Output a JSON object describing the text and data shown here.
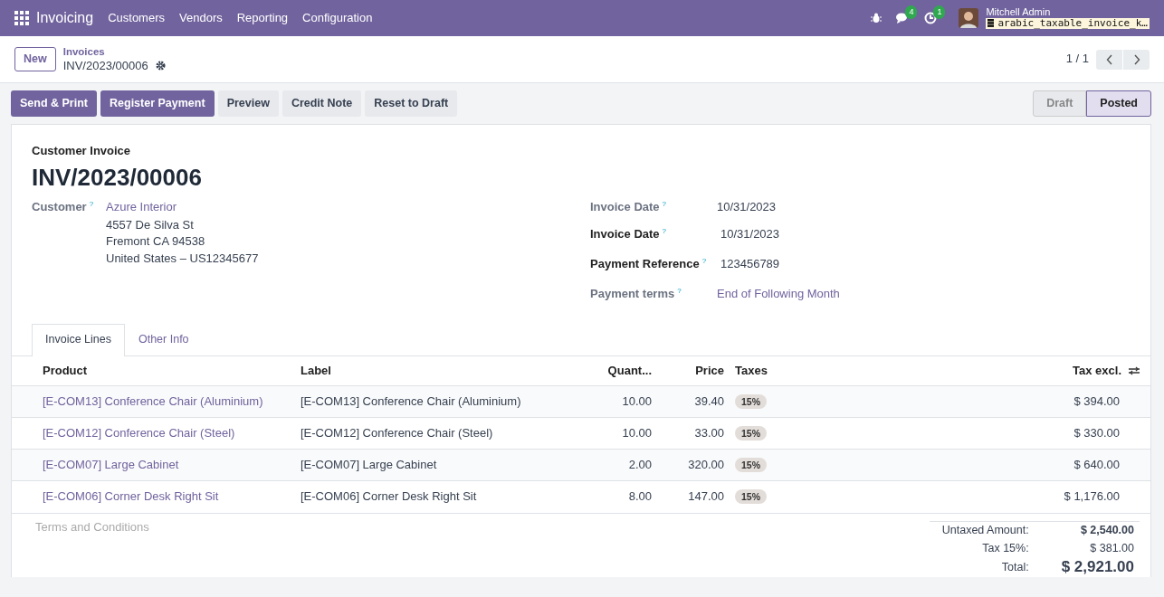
{
  "navbar": {
    "app": "Invoicing",
    "menus": [
      "Customers",
      "Vendors",
      "Reporting",
      "Configuration"
    ],
    "messages_count": "4",
    "activities_count": "1",
    "user": "Mitchell Admin",
    "database": "arabic_taxable_invoice_k…"
  },
  "control_panel": {
    "new_button": "New",
    "breadcrumb": "Invoices",
    "record": "INV/2023/00006",
    "pager": "1 / 1"
  },
  "actions": [
    {
      "label": "Send & Print",
      "primary": true
    },
    {
      "label": "Register Payment",
      "primary": true
    },
    {
      "label": "Preview",
      "primary": false
    },
    {
      "label": "Credit Note",
      "primary": false
    },
    {
      "label": "Reset to Draft",
      "primary": false
    }
  ],
  "status": [
    {
      "label": "Draft",
      "selected": false
    },
    {
      "label": "Posted",
      "selected": true
    }
  ],
  "form": {
    "type_label": "Customer Invoice",
    "name": "INV/2023/00006",
    "customer": {
      "label": "Customer",
      "help": "?",
      "name": "Azure Interior",
      "address": [
        "4557 De Silva St",
        "Fremont CA 94538",
        "United States – US12345677"
      ]
    },
    "fields": [
      {
        "label": "Invoice Date",
        "help": "?",
        "value": "10/31/2023",
        "required": false,
        "link": false
      },
      {
        "label": "Invoice Date",
        "help": "?",
        "value": "10/31/2023",
        "required": true,
        "link": false
      },
      {
        "label": "Payment Reference",
        "help": "?",
        "value": "123456789",
        "required": true,
        "link": false
      },
      {
        "label": "Payment terms",
        "help": "?",
        "value": "End of Following Month",
        "required": false,
        "link": true
      }
    ]
  },
  "tabs": [
    {
      "label": "Invoice Lines",
      "selected": true
    },
    {
      "label": "Other Info",
      "selected": false
    }
  ],
  "table": {
    "columns": [
      "Product",
      "Label",
      "Quant...",
      "Price",
      "Taxes",
      "Tax excl."
    ],
    "rows": [
      {
        "product": "[E-COM13] Conference Chair (Aluminium)",
        "label": "[E-COM13] Conference Chair (Aluminium)",
        "quantity": "10.00",
        "price": "39.40",
        "tax": "15%",
        "subtotal": "$ 394.00"
      },
      {
        "product": "[E-COM12] Conference Chair (Steel)",
        "label": "[E-COM12] Conference Chair (Steel)",
        "quantity": "10.00",
        "price": "33.00",
        "tax": "15%",
        "subtotal": "$ 330.00"
      },
      {
        "product": "[E-COM07] Large Cabinet",
        "label": "[E-COM07] Large Cabinet",
        "quantity": "2.00",
        "price": "320.00",
        "tax": "15%",
        "subtotal": "$ 640.00"
      },
      {
        "product": "[E-COM06] Corner Desk Right Sit",
        "label": "[E-COM06] Corner Desk Right Sit",
        "quantity": "8.00",
        "price": "147.00",
        "tax": "15%",
        "subtotal": "$ 1,176.00"
      }
    ]
  },
  "terms_placeholder": "Terms and Conditions",
  "totals": [
    {
      "label": "Untaxed Amount:",
      "value": "$ 2,540.00",
      "kind": "bold"
    },
    {
      "label": "Tax 15%:",
      "value": "$ 381.00",
      "kind": "normal"
    },
    {
      "label": "Total:",
      "value": "$ 2,921.00",
      "kind": "total"
    }
  ]
}
